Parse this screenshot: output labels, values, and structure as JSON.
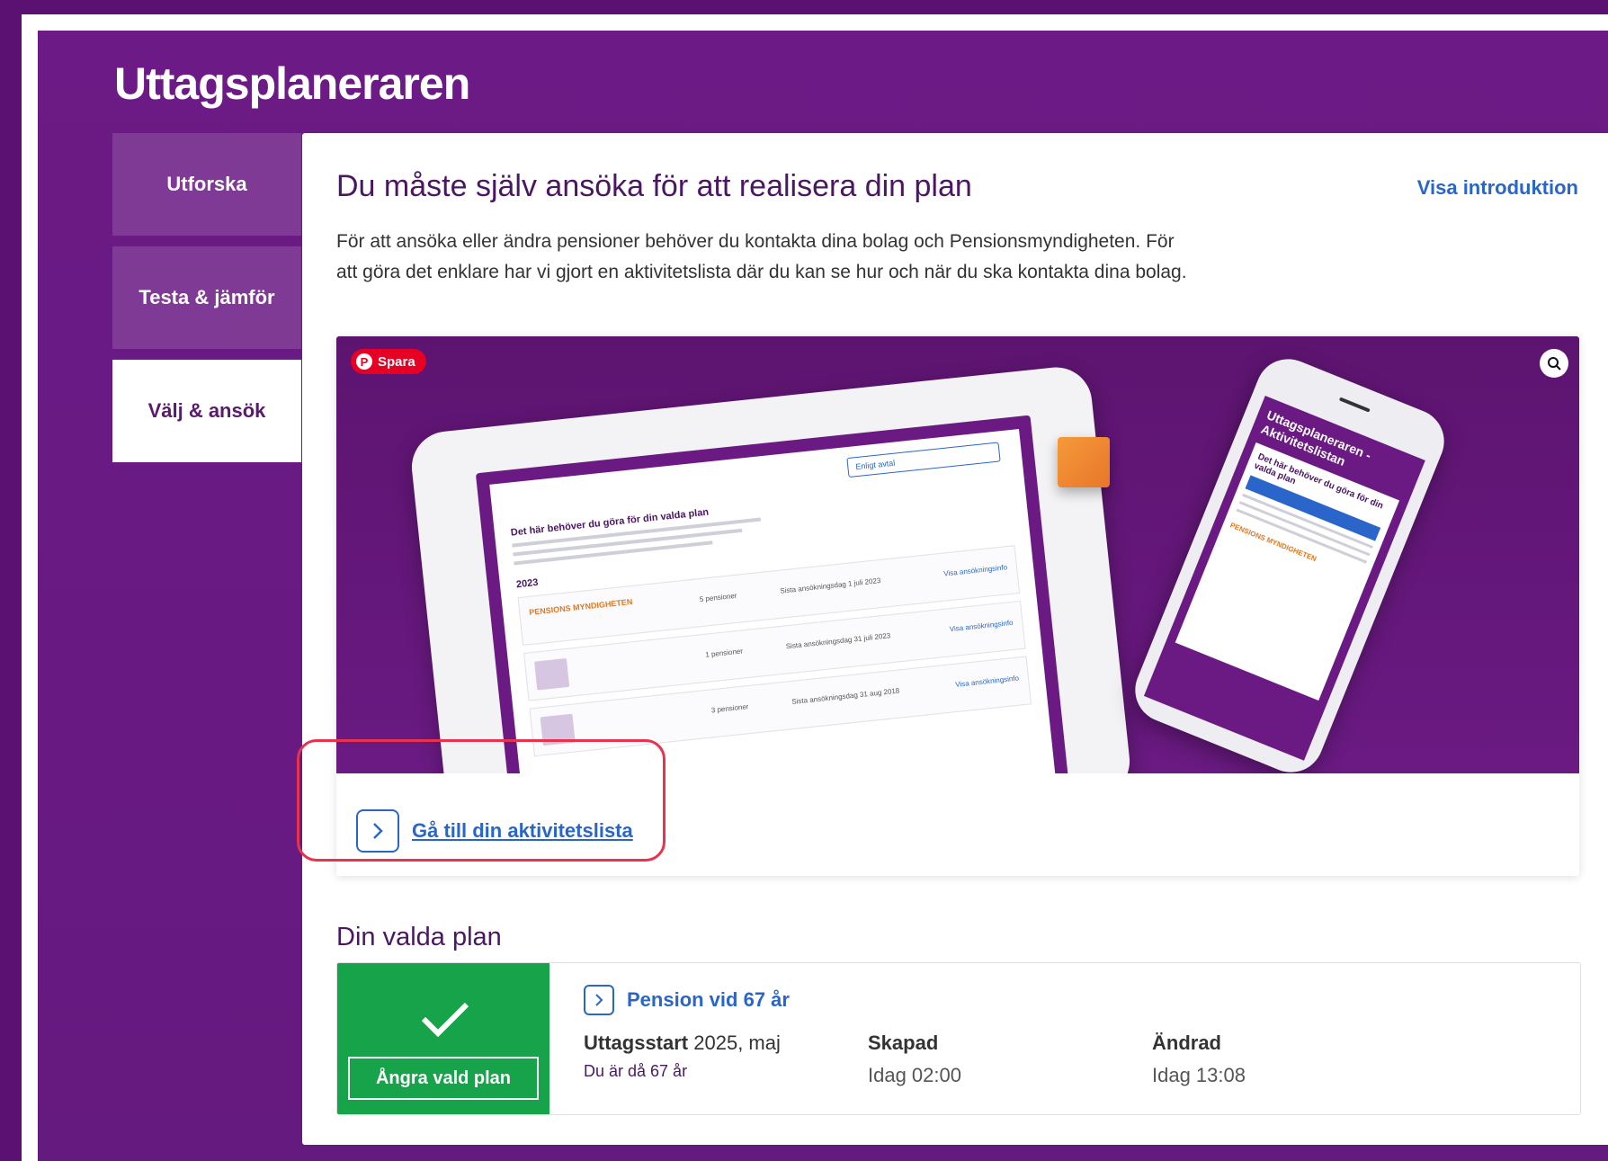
{
  "app": {
    "title": "Uttagsplaneraren"
  },
  "tabs": [
    {
      "label": "Utforska"
    },
    {
      "label": "Testa & jämför"
    },
    {
      "label": "Välj & ansök"
    }
  ],
  "main": {
    "heading": "Du måste själv ansöka för att realisera din plan",
    "intro_link": "Visa introduktion",
    "intro_text": "För att ansöka eller ändra pensioner behöver du kontakta dina bolag och Pensionsmyndigheten. För att göra det enklare har vi gjort en aktivitetslista där du kan se hur och när du ska kontakta dina bolag.",
    "image": {
      "save_badge": "Spara",
      "lens_icon": "lens-icon",
      "tablet": {
        "cta": "Enligt avtal",
        "heading": "Det här behöver du göra för din valda plan",
        "year": "2023",
        "rows": [
          {
            "logo": "PENSIONS MYNDIGHETEN",
            "col1": "5 pensioner",
            "col2": "Sista ansökningsdag 1 juli 2023",
            "link": "Visa ansökningsinfo"
          },
          {
            "logo": "",
            "col1": "1 pensioner",
            "col2": "Sista ansökningsdag 31 juli 2023",
            "link": "Visa ansökningsinfo"
          },
          {
            "logo": "",
            "col1": "3 pensioner",
            "col2": "Sista ansökningsdag 31 aug 2018",
            "link": "Visa ansökningsinfo"
          }
        ]
      },
      "phone": {
        "title": "Uttagsplaneraren - Aktivitetslistan",
        "card_heading": "Det här behöver du göra för din valda plan",
        "logo": "PENSIONS MYNDIGHETEN"
      }
    },
    "activity_link": "Gå till din aktivitetslista"
  },
  "plan": {
    "heading": "Din valda plan",
    "undo_button": "Ångra vald plan",
    "link": "Pension vid 67 år",
    "start_label": "Uttagsstart",
    "start_value": "2025, maj",
    "start_sub": "Du är då 67 år",
    "created_label": "Skapad",
    "created_value": "Idag 02:00",
    "changed_label": "Ändrad",
    "changed_value": "Idag 13:08"
  },
  "colors": {
    "brand_purple": "#6a1a82",
    "link_blue": "#2a66c9",
    "success_green": "#17a34a",
    "highlight_red": "#e8334f"
  }
}
